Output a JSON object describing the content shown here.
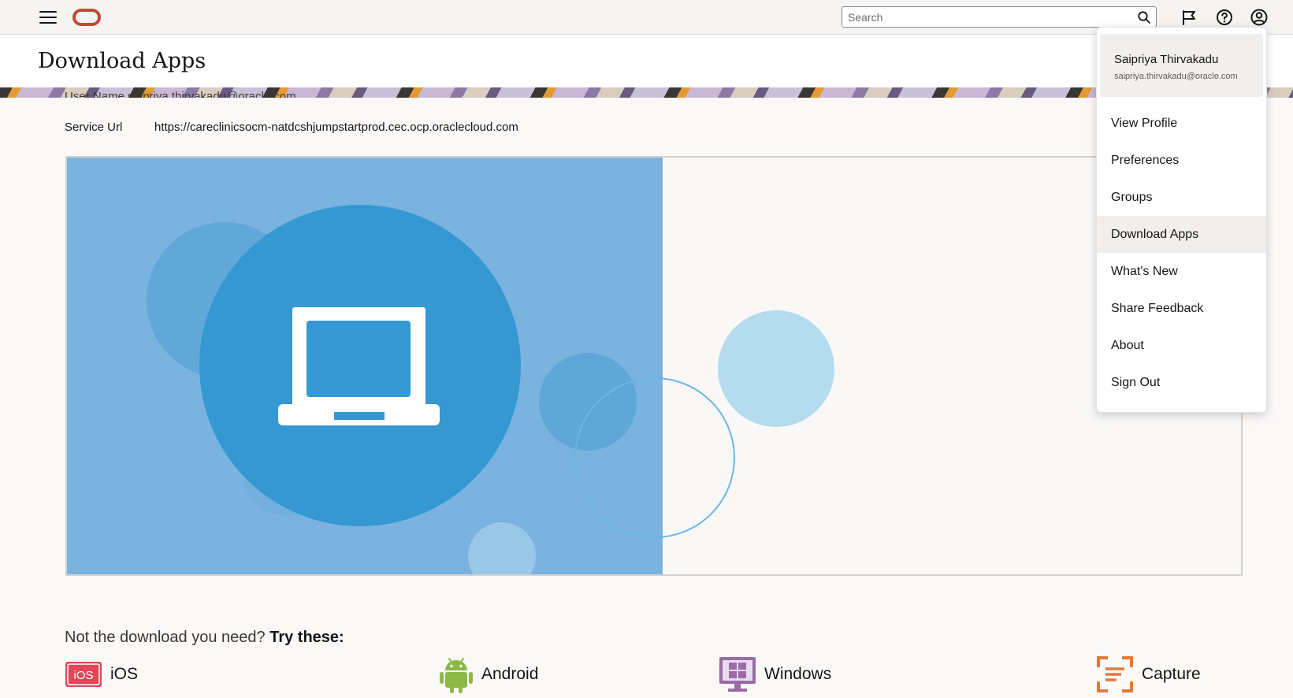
{
  "topbar": {
    "menu_icon": "hamburger-icon",
    "logo": "oracle-logo",
    "search_placeholder": "Search",
    "search_icon": "search-icon",
    "icons": [
      "flag-icon",
      "help-icon",
      "user-icon"
    ]
  },
  "page": {
    "title": "Download Apps"
  },
  "info": {
    "cut_off_row": "User Name    saipriya.thirvakadu@oracle.com",
    "service_url_label": "Service Url",
    "service_url_value": "https://careclinicsocm-natdcshjumpstartprod.cec.ocp.oraclecloud.com"
  },
  "hero": {
    "icon": "laptop-icon",
    "colors": {
      "panel": "#7ab3df",
      "circle": "#3598d2"
    }
  },
  "try_these": {
    "prefix": "Not the download you need?",
    "emphasis": "Try these:",
    "apps": [
      {
        "label": "iOS",
        "icon": "ios-icon",
        "color": "#e0475a"
      },
      {
        "label": "Android",
        "icon": "android-icon",
        "color": "#8cb947"
      },
      {
        "label": "Windows",
        "icon": "windows-icon",
        "color": "#9b6aa7"
      },
      {
        "label": "Capture",
        "icon": "capture-icon",
        "color": "#e37a3b"
      }
    ]
  },
  "user_menu": {
    "name": "Saipriya Thirvakadu",
    "email": "saipriya.thirvakadu@oracle.com",
    "items": [
      {
        "label": "View Profile"
      },
      {
        "label": "Preferences"
      },
      {
        "label": "Groups"
      },
      {
        "label": "Download Apps",
        "active": true
      },
      {
        "label": "What's New"
      },
      {
        "label": "Share Feedback"
      },
      {
        "label": "About"
      },
      {
        "label": "Sign Out"
      }
    ]
  },
  "colors": {
    "brand": "#c74634",
    "text": "#161513",
    "hover": "#f1efed"
  }
}
